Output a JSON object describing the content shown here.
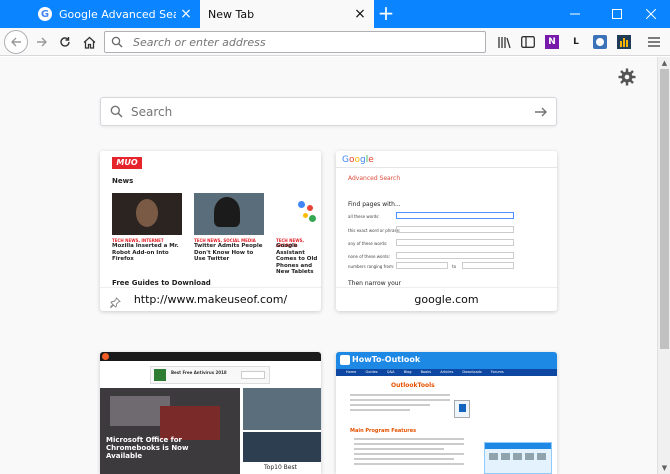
{
  "tabs": [
    {
      "title": "Google Advanced Search",
      "favicon": "google-g-icon",
      "favicon_glyph": "G",
      "active": false
    },
    {
      "title": "New Tab",
      "active": true
    }
  ],
  "tab_close_glyph": "×",
  "new_tab_glyph": "+",
  "navbar": {
    "url_placeholder": "Search or enter address",
    "toolbar_icons": [
      "library-icon",
      "sidebar-icon",
      "onenote-icon",
      "lastpass-icon",
      "extension-icon",
      "chart-extension-icon"
    ],
    "onenote_glyph": "N",
    "lastpass_glyph": "L"
  },
  "newtab": {
    "search_placeholder": "Search",
    "tiles": [
      {
        "label": "http://www.makeuseof.com/",
        "pinned": true
      },
      {
        "label": "google.com",
        "pinned": false
      },
      {
        "label": ""
      },
      {
        "label": ""
      }
    ]
  },
  "muo_thumb": {
    "logo": "MUO",
    "section": "News",
    "articles": [
      {
        "category": "TECH NEWS, INTERNET",
        "headline": "Mozilla Inserted a Mr. Robot Add-on Into Firefox"
      },
      {
        "category": "TECH NEWS, SOCIAL MEDIA",
        "headline": "Twitter Admits People Don't Know How to Use Twitter"
      },
      {
        "category": "TECH NEWS, ANDROID",
        "headline": "Google Assistant Comes to Old Phones and New Tablets"
      }
    ],
    "footer_section": "Free Guides to Download"
  },
  "google_thumb": {
    "logo": "Google",
    "page_title": "Advanced Search",
    "find_pages": "Find pages with...",
    "fields": [
      "all these words:",
      "this exact word or phrase:",
      "any of these words:",
      "none of these words:",
      "numbers ranging from:"
    ],
    "range_to": "to",
    "narrow": "Then narrow your"
  },
  "pc_thumb": {
    "headline": "Microsoft Office for Chromebooks is Now Available",
    "side_headline": "Top10 Best",
    "ad_text": "Best Free Antivirus 2018"
  },
  "outlook_thumb": {
    "brand": "HowTo-Outlook",
    "menu": [
      "Home",
      "Guides",
      "Q&A Blog",
      "Books",
      "Articles",
      "Downloads",
      "Forums"
    ],
    "page_heading": "OutlookTools",
    "features_heading": "Main Program Features"
  },
  "colors": {
    "tab_strip": "#0a84ff",
    "active_tab": "#f9f9fa",
    "muo_red": "#e5242b",
    "outlook_blue": "#1e88e5"
  }
}
